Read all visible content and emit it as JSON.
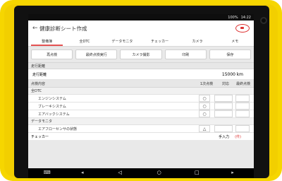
{
  "status": {
    "battery": "100%",
    "time": "14:22"
  },
  "appbar": {
    "title": "健康診断シート作成"
  },
  "tabs": [
    {
      "label": "整備簿"
    },
    {
      "label": "全DTC"
    },
    {
      "label": "データモニタ"
    },
    {
      "label": "チェッカー"
    },
    {
      "label": "カメラ"
    },
    {
      "label": "メモ"
    }
  ],
  "actions": [
    {
      "label": "再点検"
    },
    {
      "label": "最終点検実行"
    },
    {
      "label": "カメラ撮影"
    },
    {
      "label": "印刷"
    },
    {
      "label": "保存"
    }
  ],
  "distance": {
    "section_label": "走行距離",
    "field_label": "走行距離",
    "value": "15000",
    "unit": "km"
  },
  "inspection": {
    "section_label": "点検内容",
    "col_first": "1次点検",
    "col_action": "対応",
    "col_final": "最終点検",
    "groups": [
      {
        "name": "全DTC",
        "items": [
          {
            "label": "エンジンシステム",
            "mark": "○"
          },
          {
            "label": "ブレーキシステム",
            "mark": "○"
          },
          {
            "label": "エアバックシステム",
            "mark": "○"
          }
        ]
      },
      {
        "name": "データモニタ",
        "items": [
          {
            "label": "エアフローセンサの状態",
            "mark": "△"
          }
        ]
      }
    ],
    "bottom": {
      "label": "チェッカー",
      "mid": "手入力",
      "badge": "(件)"
    }
  }
}
